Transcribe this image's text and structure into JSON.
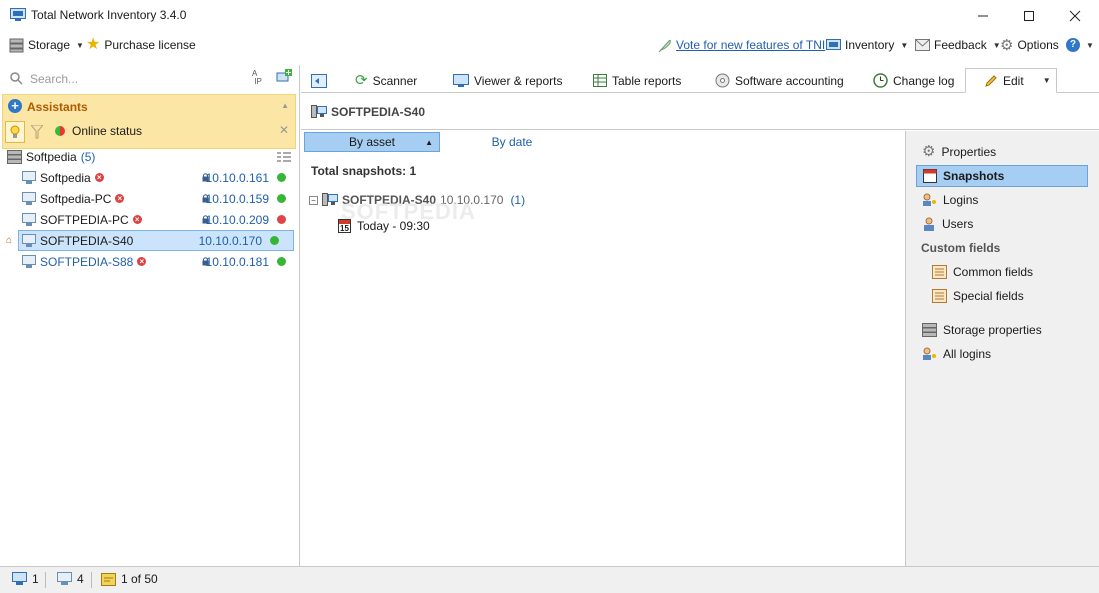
{
  "window": {
    "title": "Total Network Inventory 3.4.0"
  },
  "toolbar": {
    "storage": "Storage",
    "purchase": "Purchase license",
    "vote": "Vote for new features of TNI",
    "inventory": "Inventory",
    "feedback": "Feedback",
    "options": "Options"
  },
  "search": {
    "placeholder": "Search..."
  },
  "assistants": {
    "title": "Assistants",
    "filter_label": "Online status"
  },
  "tree": {
    "group": {
      "name": "Softpedia",
      "count": "(5)"
    },
    "items": [
      {
        "name": "Softpedia",
        "ip": "10.10.0.161",
        "error": true,
        "status_color": "#35b735",
        "selected": false
      },
      {
        "name": "Softpedia-PC",
        "ip": "10.10.0.159",
        "error": true,
        "status_color": "#35b735",
        "selected": false
      },
      {
        "name": "SOFTPEDIA-PC",
        "ip": "10.10.0.209",
        "error": true,
        "status_color": "#e04444",
        "selected": false
      },
      {
        "name": "SOFTPEDIA-S40",
        "ip": "10.10.0.170",
        "error": false,
        "status_color": "#35b735",
        "selected": true
      },
      {
        "name": "SOFTPEDIA-S88",
        "ip": "10.10.0.181",
        "error": true,
        "status_color": "#35b735",
        "selected": false
      }
    ]
  },
  "tabs": [
    "Scanner",
    "Viewer & reports",
    "Table reports",
    "Software accounting",
    "Change log",
    "Edit"
  ],
  "asset": {
    "name": "SOFTPEDIA-S40"
  },
  "snapshots": {
    "by_asset": "By asset",
    "by_date": "By date",
    "total": "Total snapshots: 1",
    "root_name": "SOFTPEDIA-S40",
    "root_ip": "10.10.0.170",
    "root_count": "(1)",
    "entry": "Today - 09:30",
    "calendar_day": "15"
  },
  "watermark": "SOFTPEDIA",
  "right_panel": {
    "properties": "Properties",
    "snapshots": "Snapshots",
    "logins": "Logins",
    "users": "Users",
    "custom_fields": "Custom fields",
    "common_fields": "Common fields",
    "special_fields": "Special fields",
    "storage_properties": "Storage properties",
    "all_logins": "All logins"
  },
  "statusbar": {
    "computers": "1",
    "offline": "4",
    "pages": "1 of 50"
  },
  "colors": {
    "accent": "#1f5fad",
    "selection": "#a6cef3",
    "assistant_bg": "#fbe6a6"
  }
}
